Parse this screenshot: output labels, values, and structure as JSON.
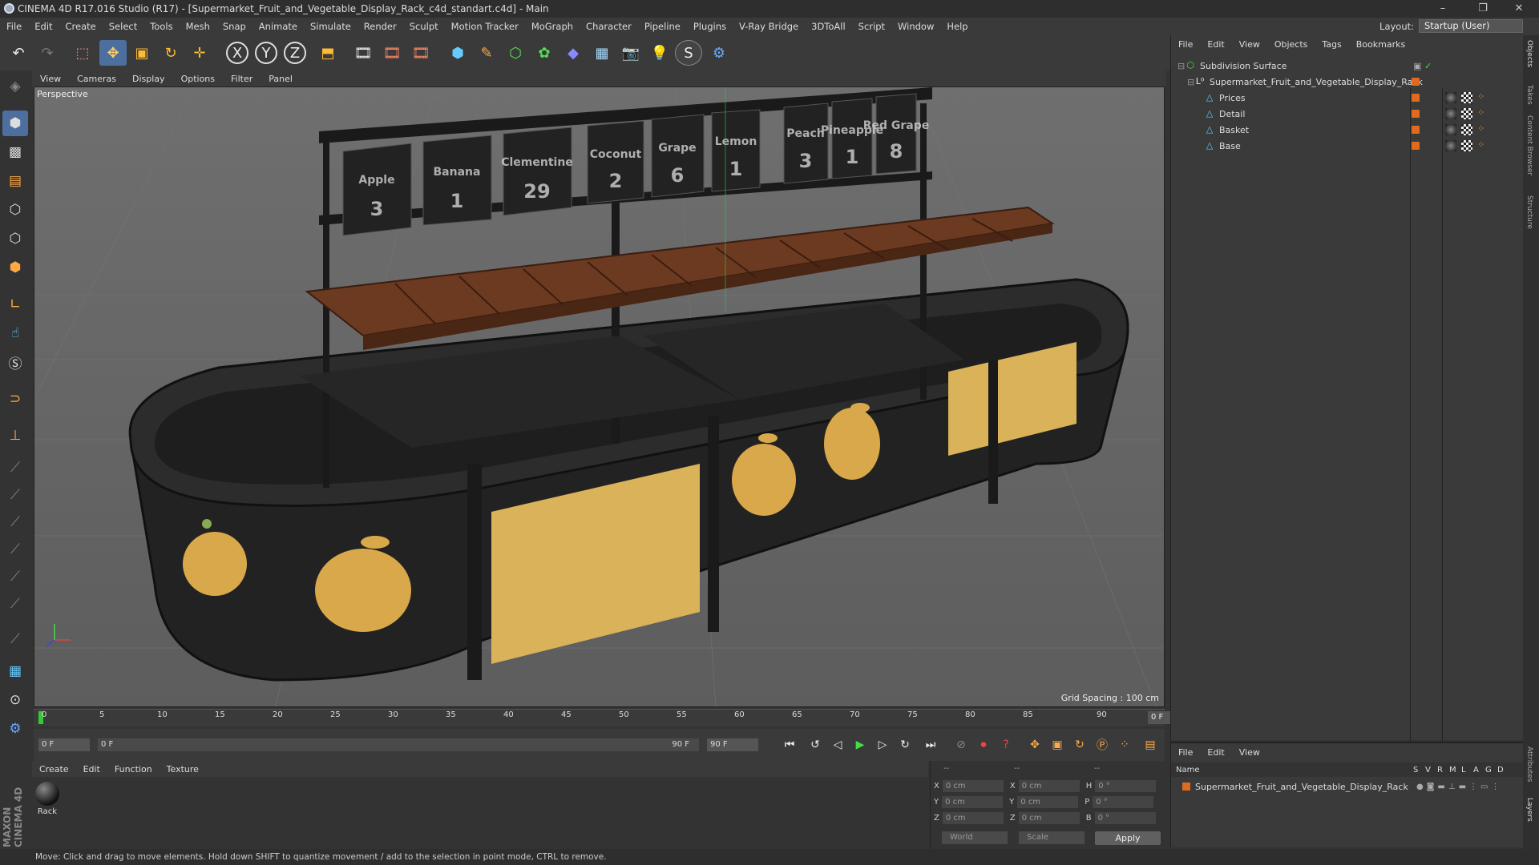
{
  "window": {
    "title": "CINEMA 4D R17.016 Studio (R17) - [Supermarket_Fruit_and_Vegetable_Display_Rack_c4d_standart.c4d] - Main",
    "min": "–",
    "restore": "❐",
    "close": "✕"
  },
  "menubar": [
    "File",
    "Edit",
    "Create",
    "Select",
    "Tools",
    "Mesh",
    "Snap",
    "Animate",
    "Simulate",
    "Render",
    "Sculpt",
    "Motion Tracker",
    "MoGraph",
    "Character",
    "Pipeline",
    "Plugins",
    "V-Ray Bridge",
    "3DToAll",
    "Script",
    "Window",
    "Help"
  ],
  "layout": {
    "label": "Layout:",
    "value": "Startup (User)"
  },
  "viewport": {
    "menu": [
      "View",
      "Cameras",
      "Display",
      "Options",
      "Filter",
      "Panel"
    ],
    "label": "Perspective",
    "grid_spacing": "Grid Spacing : 100 cm",
    "price_signs": [
      {
        "name": "Apple",
        "price": "3"
      },
      {
        "name": "Banana",
        "price": "1"
      },
      {
        "name": "Clementine",
        "price": "29"
      },
      {
        "name": "Coconut",
        "price": "2"
      },
      {
        "name": "Grape",
        "price": "6"
      },
      {
        "name": "Lemon",
        "price": "1"
      },
      {
        "name": "Peach",
        "price": "3"
      },
      {
        "name": "Pineapple",
        "price": "1"
      },
      {
        "name": "Red Grape",
        "price": "8"
      }
    ]
  },
  "timeline": {
    "ticks": [
      "0",
      "5",
      "10",
      "15",
      "20",
      "25",
      "30",
      "35",
      "40",
      "45",
      "50",
      "55",
      "60",
      "65",
      "70",
      "75",
      "80",
      "85",
      "90"
    ],
    "current_frame": "0 F"
  },
  "playbar": {
    "start": "0 F",
    "range_start": "0 F",
    "range_end": "90 F",
    "end": "90 F"
  },
  "material_panel": {
    "menu": [
      "Create",
      "Edit",
      "Function",
      "Texture"
    ],
    "materials": [
      {
        "name": "Rack"
      }
    ]
  },
  "coordinates": {
    "header": [
      "--",
      "--",
      "--"
    ],
    "rows": [
      {
        "a": "X",
        "av": "0 cm",
        "b": "X",
        "bv": "0 cm",
        "c": "H",
        "cv": "0 °"
      },
      {
        "a": "Y",
        "av": "0 cm",
        "b": "Y",
        "bv": "0 cm",
        "c": "P",
        "cv": "0 °"
      },
      {
        "a": "Z",
        "av": "0 cm",
        "b": "Z",
        "bv": "0 cm",
        "c": "B",
        "cv": "0 °"
      }
    ],
    "mode": "World",
    "scale": "Scale",
    "apply": "Apply"
  },
  "object_manager": {
    "menu": [
      "File",
      "Edit",
      "View",
      "Objects",
      "Tags",
      "Bookmarks"
    ],
    "items": [
      {
        "name": "Subdivision Surface",
        "indent": 0
      },
      {
        "name": "Supermarket_Fruit_and_Vegetable_Display_Rack",
        "indent": 1
      },
      {
        "name": "Prices",
        "indent": 2
      },
      {
        "name": "Detail",
        "indent": 2
      },
      {
        "name": "Basket",
        "indent": 2
      },
      {
        "name": "Base",
        "indent": 2
      }
    ]
  },
  "layer_manager": {
    "menu": [
      "File",
      "Edit",
      "View"
    ],
    "header": {
      "name": "Name",
      "cols": [
        "S",
        "V",
        "R",
        "M",
        "L",
        "A",
        "G",
        "D"
      ]
    },
    "rows": [
      {
        "name": "Supermarket_Fruit_and_Vegetable_Display_Rack"
      }
    ]
  },
  "side_tabs": [
    "Objects",
    "Takes",
    "Content Browser",
    "Structure"
  ],
  "side_tabs_bottom": [
    "Attributes",
    "Layers"
  ],
  "status": "Move: Click and drag to move elements. Hold down SHIFT to quantize movement / add to the selection in point mode, CTRL to remove.",
  "brand": "MAXON CINEMA 4D",
  "colors": {
    "accent": "#e06a20",
    "selection": "#4d6fa0",
    "wood": "#6b3a20",
    "panel": "#d9b25a"
  }
}
